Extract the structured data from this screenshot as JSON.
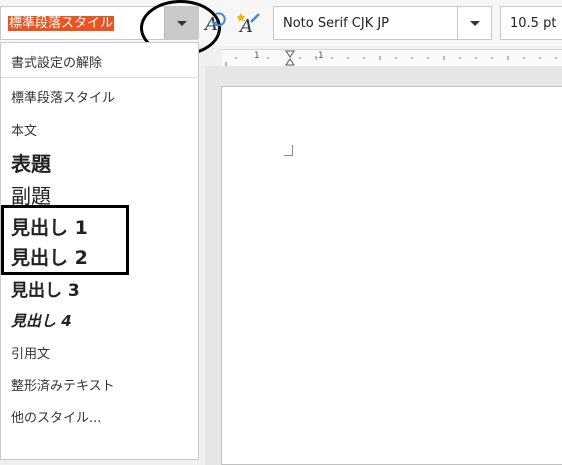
{
  "toolbar": {
    "paragraph_style": "標準段落スタイル",
    "font_name": "Noto Serif CJK JP",
    "font_size": "10.5 pt"
  },
  "style_list": {
    "items": [
      "書式設定の解除",
      "標準段落スタイル",
      "本文",
      "表題",
      "副題",
      "見出し 1",
      "見出し 2",
      "見出し 3",
      "見出し 4",
      "引用文",
      "整形済みテキスト",
      "他のスタイル..."
    ]
  },
  "ruler": {
    "labels": [
      "1",
      "1"
    ]
  },
  "colors": {
    "selection": "#e95420",
    "annotation": "#000000"
  }
}
